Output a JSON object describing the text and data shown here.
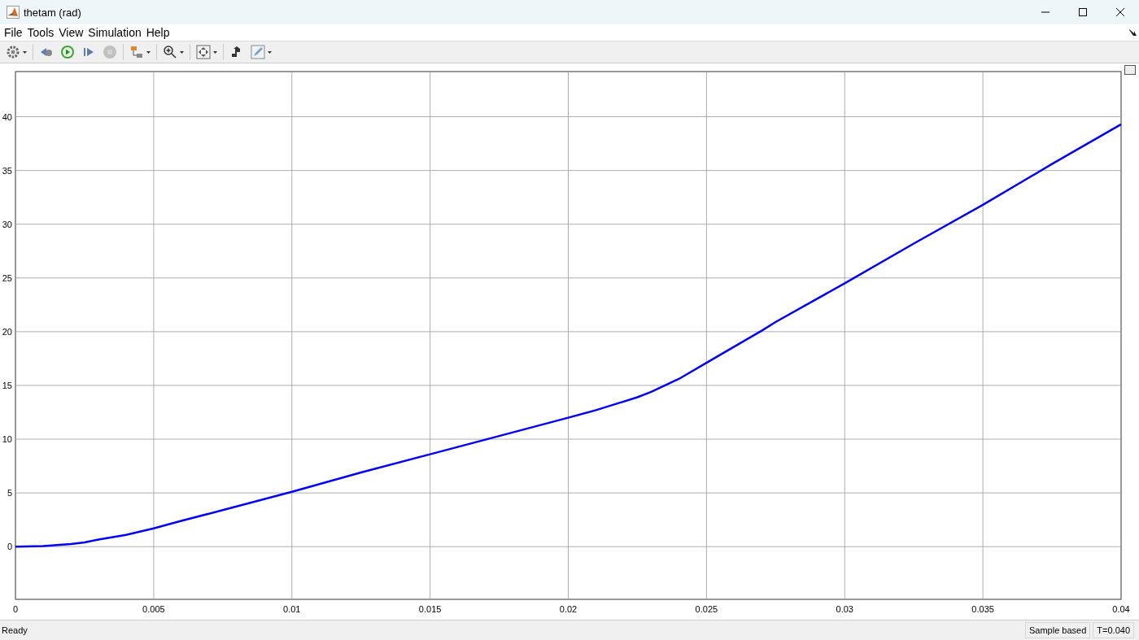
{
  "window": {
    "title": "thetam (rad)"
  },
  "menu": [
    "File",
    "Tools",
    "View",
    "Simulation",
    "Help"
  ],
  "toolbar": [
    {
      "kind": "settings",
      "dropdown": true,
      "disabled": false
    },
    {
      "kind": "step-back",
      "dropdown": false,
      "disabled": false
    },
    {
      "kind": "run",
      "dropdown": false,
      "disabled": false
    },
    {
      "kind": "step-forward",
      "dropdown": false,
      "disabled": false
    },
    {
      "kind": "stop",
      "dropdown": false,
      "disabled": true
    },
    {
      "kind": "triggers",
      "dropdown": true,
      "disabled": false
    },
    {
      "kind": "zoom",
      "dropdown": true,
      "disabled": false
    },
    {
      "kind": "fit",
      "dropdown": true,
      "disabled": false
    },
    {
      "kind": "restore",
      "dropdown": false,
      "disabled": false
    },
    {
      "kind": "style",
      "dropdown": true,
      "disabled": false
    }
  ],
  "plot": {
    "chart_data": {
      "type": "line",
      "grid": true,
      "xlim": [
        0,
        0.04
      ],
      "ylim": [
        -4.9,
        44.2
      ],
      "xticks": [
        0,
        {
          "value": 0.005,
          "label": "0.005"
        },
        {
          "value": 0.01,
          "label": "0.01"
        },
        {
          "value": 0.015,
          "label": "0.015"
        },
        {
          "value": 0.02,
          "label": "0.02"
        },
        {
          "value": 0.025,
          "label": "0.025"
        },
        {
          "value": 0.03,
          "label": "0.03"
        },
        {
          "value": 0.035,
          "label": "0.035"
        },
        {
          "value": 0.04,
          "label": "0.04"
        }
      ],
      "yticks": [
        0,
        5,
        10,
        15,
        20,
        25,
        30,
        35,
        40
      ],
      "x": [
        0,
        0.001,
        0.002,
        0.0025,
        0.003,
        0.004,
        0.005,
        0.006,
        0.0075,
        0.01,
        0.0125,
        0.015,
        0.0175,
        0.02,
        0.021,
        0.0225,
        0.023,
        0.024,
        0.025,
        0.026,
        0.027,
        0.0275,
        0.03,
        0.0325,
        0.035,
        0.0375,
        0.04
      ],
      "series": [
        {
          "color": "#0000ff",
          "values": [
            0,
            0.05,
            0.25,
            0.4,
            0.65,
            1.1,
            1.7,
            2.4,
            3.4,
            5.1,
            6.9,
            8.6,
            10.3,
            12,
            12.7,
            13.9,
            14.4,
            15.6,
            17.1,
            18.6,
            20.1,
            20.9,
            24.5,
            28.2,
            31.8,
            35.6,
            39.3
          ]
        }
      ]
    }
  },
  "status_bar": {
    "message": "Ready",
    "mode": "Sample based",
    "time": "T=0.040"
  }
}
